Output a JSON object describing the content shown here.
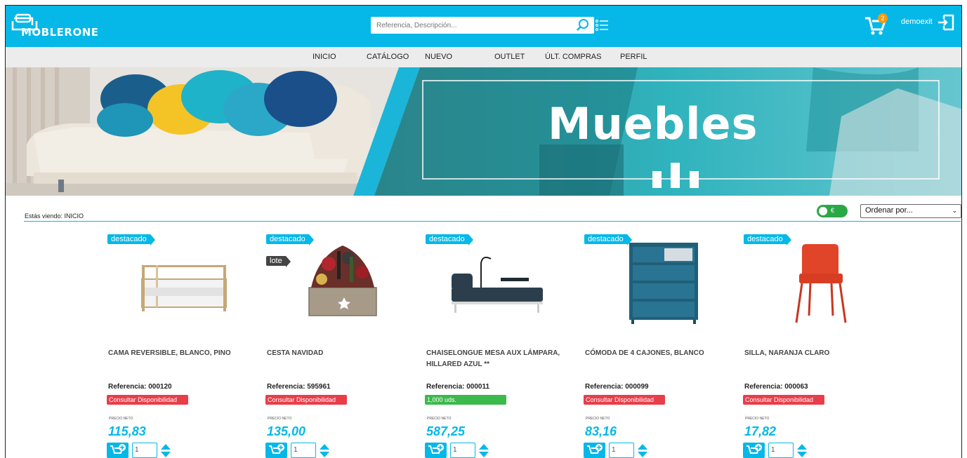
{
  "header": {
    "logo_text": "MOBLERONE",
    "search_placeholder": "Referencia, Descripción...",
    "cart_count": "2",
    "user": "demoexit",
    "accent": "#05b8e8"
  },
  "nav": {
    "items": [
      "INICIO",
      "CATÁLOGO",
      "NUEVO",
      "OUTLET",
      "ÚLT. COMPRAS",
      "PERFIL"
    ]
  },
  "banner": {
    "title": "Muebles"
  },
  "breadcrumb": "Estás viendo: INICIO",
  "currency_toggle": {
    "label": "€",
    "on": true
  },
  "sort": {
    "selected": "Ordenar por..."
  },
  "products": [
    {
      "tag": "destacado",
      "name": "CAMA REVERSIBLE, BLANCO, PINO",
      "ref": "Referencia: 000120",
      "availability": "Consultar Disponibilidad",
      "availability_status": "red",
      "price_label": "PRECIO NETO",
      "price": "115,83",
      "qty": "1",
      "image_icon": "bed-icon"
    },
    {
      "tag": "destacado",
      "tag2": "lote",
      "name": "CESTA NAVIDAD",
      "ref": "Referencia: 595961",
      "availability": "Consultar Disponibilidad",
      "availability_status": "red",
      "price_label": "PRECIO NETO",
      "price": "135,00",
      "qty": "1",
      "image_icon": "gift-basket-icon"
    },
    {
      "tag": "destacado",
      "name": "CHAISELONGUE MESA AUX LÁMPARA, HILLARED AZUL **",
      "ref": "Referencia: 000011",
      "availability": "1,000 uds.",
      "availability_status": "green",
      "price_label": "PRECIO NETO",
      "price": "587,25",
      "qty": "1",
      "image_icon": "chaise-longue-icon"
    },
    {
      "tag": "destacado",
      "name": "CÓMODA DE 4 CAJONES, BLANCO",
      "ref": "Referencia: 000099",
      "availability": "Consultar Disponibilidad",
      "availability_status": "red",
      "price_label": "PRECIO NETO",
      "price": "83,16",
      "qty": "1",
      "image_icon": "dresser-icon"
    },
    {
      "tag": "destacado",
      "name": "SILLA, NARANJA CLARO",
      "ref": "Referencia: 000063",
      "availability": "Consultar Disponibilidad",
      "availability_status": "red",
      "price_label": "PRECIO NETO",
      "price": "17,82",
      "qty": "1",
      "image_icon": "chair-icon"
    }
  ]
}
